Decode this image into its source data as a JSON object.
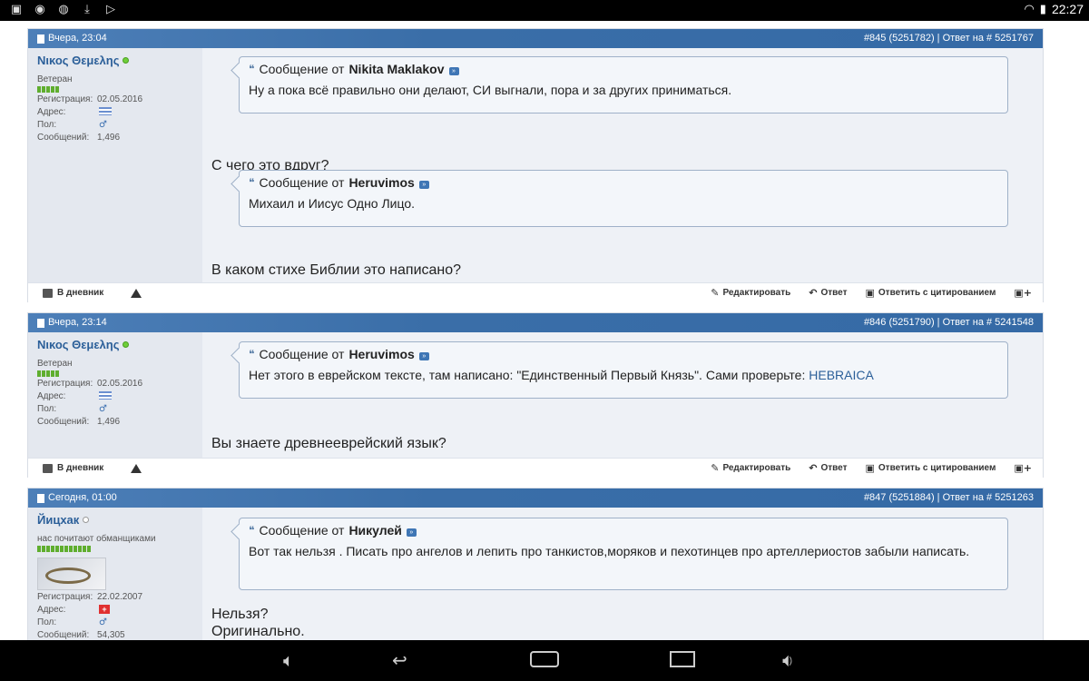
{
  "status_bar": {
    "time": "22:27",
    "left_icons": [
      "gallery-icon",
      "app-icon",
      "chat-icon",
      "download-icon",
      "media-icon"
    ],
    "right_icons": [
      "wifi-icon",
      "battery-icon"
    ]
  },
  "posts": [
    {
      "date": "Вчера, 23:04",
      "meta": "#845 (5251782) | Ответ на # 5251767",
      "user": {
        "name": "Νικος Θεμελης",
        "title": "Ветеран",
        "reg_label": "Регистрация:",
        "reg_value": "02.05.2016",
        "addr_label": "Адрес:",
        "sex_label": "Пол:",
        "posts_label": "Сообщений:",
        "posts_value": "1,496"
      },
      "quotes": [
        {
          "prefix": "Сообщение от",
          "author": "Nikita Maklakov",
          "text": "Ну а пока всё правильно они делают, СИ выгнали, пора и за других приниматься."
        },
        {
          "prefix": "Сообщение от",
          "author": "Heruvimos",
          "text": "Михаил и Иисус Одно Лицо."
        }
      ],
      "replies": [
        "С чего это вдруг?",
        "В каком стихе Библии это написано?"
      ]
    },
    {
      "date": "Вчера, 23:14",
      "meta": "#846 (5251790) | Ответ на # 5241548",
      "user": {
        "name": "Νικος Θεμελης",
        "title": "Ветеран",
        "reg_label": "Регистрация:",
        "reg_value": "02.05.2016",
        "addr_label": "Адрес:",
        "sex_label": "Пол:",
        "posts_label": "Сообщений:",
        "posts_value": "1,496"
      },
      "quotes": [
        {
          "prefix": "Сообщение от",
          "author": "Heruvimos",
          "text": "Нет этого в еврейском тексте, там написано: \"Единственный Первый Князь\". Сами проверьте: ",
          "link": "HEBRAICA"
        }
      ],
      "replies": [
        "Вы знаете древнееврейский язык?"
      ]
    },
    {
      "date": "Сегодня, 01:00",
      "meta": "#847 (5251884) | Ответ на # 5251263",
      "user": {
        "name": "Йицхак",
        "title": "нас почитают обманщиками",
        "reg_label": "Регистрация:",
        "reg_value": "22.02.2007",
        "addr_label": "Адрес:",
        "sex_label": "Пол:",
        "posts_label": "Сообщений:",
        "posts_value": "54,305"
      },
      "quotes": [
        {
          "prefix": "Сообщение от",
          "author": "Никулей",
          "text": "Вот так нельзя . Писать про ангелов и лепить про танкистов,моряков и пехотинцев про артеллериостов забыли написать."
        }
      ],
      "replies": [
        "Нельзя?",
        "Оригинально."
      ]
    }
  ],
  "footer": {
    "diary": "В дневник",
    "edit": "Редактировать",
    "reply": "Ответ",
    "quote_reply": "Ответить с цитированием"
  },
  "colors": {
    "header_blue": "#3a6ea8",
    "username_blue": "#2b5f99",
    "post_bg": "#eef1f6",
    "user_col_bg": "#e4e8ef"
  },
  "nav_icons": [
    "volume-down-icon",
    "back-icon",
    "home-icon",
    "recents-icon",
    "volume-up-icon"
  ]
}
